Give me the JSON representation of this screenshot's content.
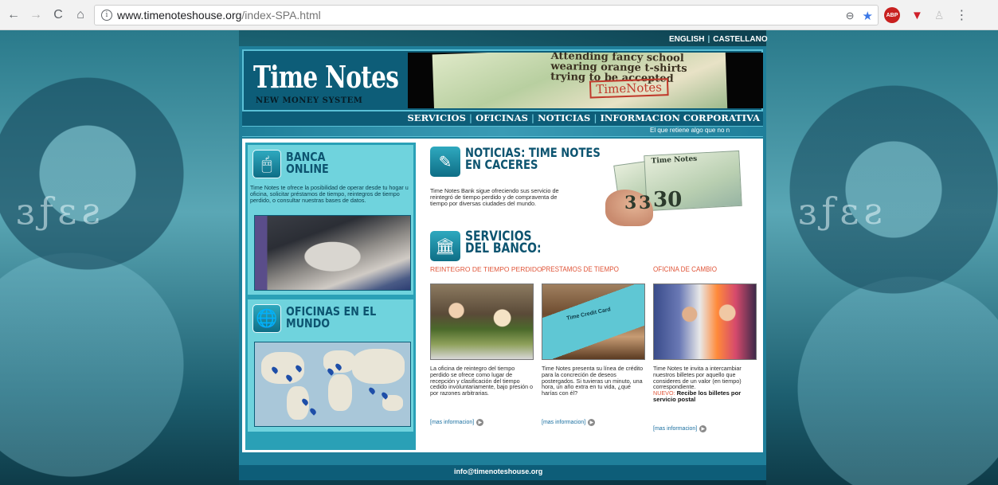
{
  "browser": {
    "url_domain": "www.timenoteshouse.org",
    "url_path": "/index-SPA.html",
    "back_icon": "arrow-left-icon",
    "forward_icon": "arrow-right-icon",
    "reload_icon": "reload-icon",
    "home_icon": "home-icon",
    "abp_label": "ABP"
  },
  "bg_text_left": "ɜƒɛƨ",
  "bg_text_right": "ɜƒɛƨ",
  "langs": {
    "english": "ENGLISH",
    "castellano": "CASTELLANO"
  },
  "header": {
    "logo_title": "Time Notes",
    "logo_sub": "NEW MONEY SYSTEM",
    "banner_text": "Attending fancy school wearing orange t-shirts trying to be accepted",
    "banner_stamp": "TimeNotes"
  },
  "nav": {
    "items": [
      "SERVICIOS",
      "OFICINAS",
      "NOTICIAS",
      "INFORMACION CORPORATIVA"
    ]
  },
  "ticker": "El que retiene algo que no n",
  "banca": {
    "title_1": "BANCA",
    "title_2": "ONLINE",
    "text": "Time Notes te ofrece la posibilidad de operar desde tu hogar u oficina, solicitar préstamos de tiempo, reintegros de tiempo perdido, o consultar nuestras bases de datos."
  },
  "oficinas": {
    "title_1": "OFICINAS EN EL",
    "title_2": "MUNDO"
  },
  "noticias": {
    "title_1": "NOTICIAS: TIME NOTES",
    "title_2": "EN CACERES",
    "text": "Time Notes Bank sigue ofreciendo sus servicio de reintegró de tiempo perdido y de compraventa de tiempo por diversas ciudades del mundo.",
    "bill_numbers": [
      "3",
      "3",
      "30"
    ],
    "bill_label": "Time Notes"
  },
  "servicios": {
    "title_1": "SERVICIOS",
    "title_2": "DEL BANCO:",
    "columns": [
      {
        "head": "REINTEGRO DE TIEMPO PERDIDO",
        "text": "La oficina de reintegro del tiempo perdido se ofrece como lugar de recepción y clasificación del tiempo cedido involuntariamente, bajo presión o por razones arbitrarias.",
        "more": "[mas informacion]"
      },
      {
        "head": "PRESTAMOS DE TIEMPO",
        "text": "Time Notes presenta su línea de crédito para la concreción de deseos postergados. Si tuvieras un minuto, una hora, un año extra en tu vida, ¿qué harías con él?",
        "more": "[mas informacion]",
        "card_label": "Time Credit Card"
      },
      {
        "head": "OFICINA DE CAMBIO",
        "text": "Time Notes te invita a intercambiar nuestros billetes por aquello que consideres de un valor (en tiempo) correspondiente.",
        "nuevo": "NUEVO:",
        "nuevo_text": "Recibe los billetes por servicio postal",
        "more": "[mas informacion]"
      }
    ]
  },
  "footer": {
    "email": "info@timenoteshouse.org"
  }
}
